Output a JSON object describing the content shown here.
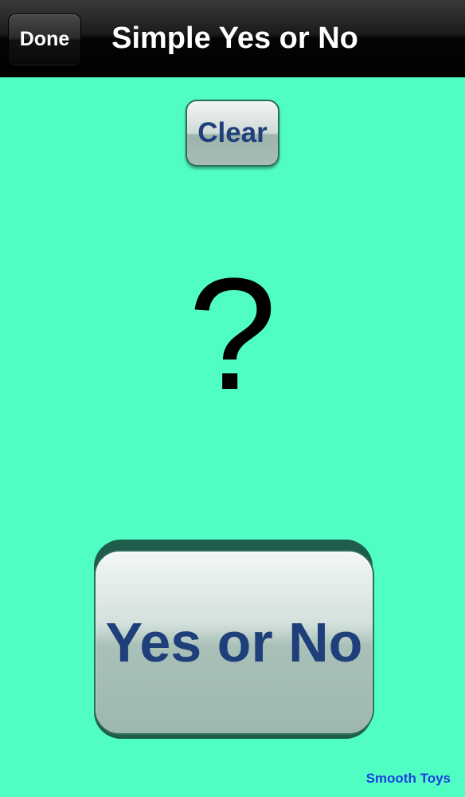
{
  "navbar": {
    "done_label": "Done",
    "title": "Simple Yes or No"
  },
  "controls": {
    "clear_label": "Clear",
    "answer_text": "?",
    "main_button_label": "Yes or No"
  },
  "footer": {
    "credit_label": "Smooth Toys"
  },
  "colors": {
    "background": "#50fec4",
    "button_text": "#1f3f7a",
    "credit_link": "#1d3fe0"
  }
}
